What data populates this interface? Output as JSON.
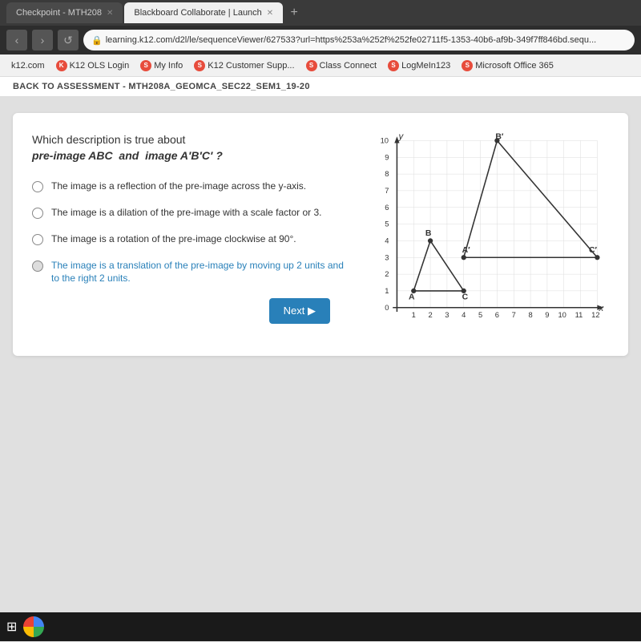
{
  "browser": {
    "tabs": [
      {
        "label": "Checkpoint - MTH208",
        "active": false,
        "id": "tab-checkpoint"
      },
      {
        "label": "Blackboard Collaborate | Launch",
        "active": true,
        "id": "tab-blackboard"
      }
    ],
    "tab_new_label": "+",
    "address_bar": {
      "url": "learning.k12.com/d2l/le/sequenceViewer/627533?url=https%253a%252f%252fe02711f5-1353-40b6-af9b-349f7ff846bd.sequ..."
    },
    "bookmarks": [
      {
        "label": "k12.com",
        "icon": "k"
      },
      {
        "label": "K12 OLS Login",
        "icon": "K"
      },
      {
        "label": "My Info",
        "icon": "S"
      },
      {
        "label": "K12 Customer Supp...",
        "icon": "S"
      },
      {
        "label": "Class Connect",
        "icon": "S"
      },
      {
        "label": "LogMeIn123",
        "icon": "S"
      },
      {
        "label": "Microsoft Office 365",
        "icon": "S"
      }
    ]
  },
  "page": {
    "back_bar": "BACK TO ASSESSMENT - MTH208A_GEOMCA_SEC22_SEM1_19-20",
    "question": {
      "intro": "Which description is true about",
      "highlighted": "pre-image ABC  and  image A′B′C′  ?",
      "options": [
        {
          "id": "opt1",
          "text": "The image is a reflection of the pre-image across the y-axis.",
          "selected": false
        },
        {
          "id": "opt2",
          "text": "The image is a dilation of the pre-image with a scale factor or 3.",
          "selected": false
        },
        {
          "id": "opt3",
          "text": "The image is a rotation of the pre-image clockwise at 90°.",
          "selected": false
        },
        {
          "id": "opt4",
          "text": "The image is a translation of the pre-image by moving up 2 units and to the right 2 units.",
          "selected": true
        }
      ]
    },
    "graph": {
      "x_label": "x",
      "y_label": "y",
      "x_max": 13,
      "y_max": 10,
      "points_abc": [
        {
          "label": "A",
          "x": 1,
          "y": 1
        },
        {
          "label": "B",
          "x": 2,
          "y": 4
        },
        {
          "label": "C",
          "x": 4,
          "y": 1
        }
      ],
      "points_abc_prime": [
        {
          "label": "A′",
          "x": 4,
          "y": 3
        },
        {
          "label": "B′",
          "x": 6,
          "y": 10
        },
        {
          "label": "C′",
          "x": 13,
          "y": 3
        }
      ]
    },
    "next_button_label": "Next ▶"
  },
  "taskbar": {
    "windows_label": "⊞"
  }
}
